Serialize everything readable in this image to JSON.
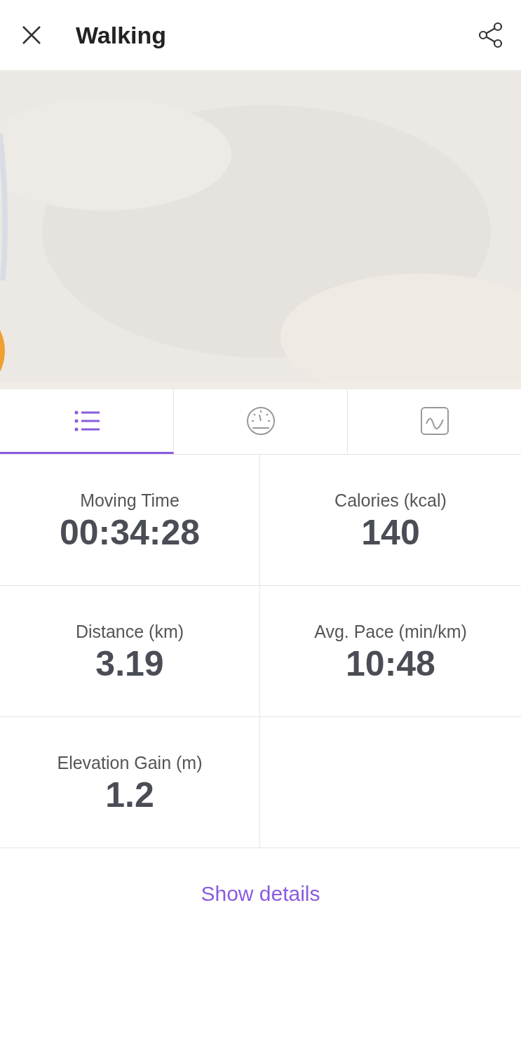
{
  "header": {
    "title": "Walking"
  },
  "tabs": [
    {
      "kind": "list",
      "selected": true
    },
    {
      "kind": "gauge",
      "selected": false
    },
    {
      "kind": "chart",
      "selected": false
    }
  ],
  "stats": [
    {
      "label": "Moving Time",
      "value": "00:34:28"
    },
    {
      "label": "Calories (kcal)",
      "value": "140"
    },
    {
      "label": "Distance (km)",
      "value": "3.19"
    },
    {
      "label": "Avg. Pace (min/km)",
      "value": "10:48"
    },
    {
      "label": "Elevation Gain (m)",
      "value": "1.2"
    }
  ],
  "details_link": "Show details"
}
